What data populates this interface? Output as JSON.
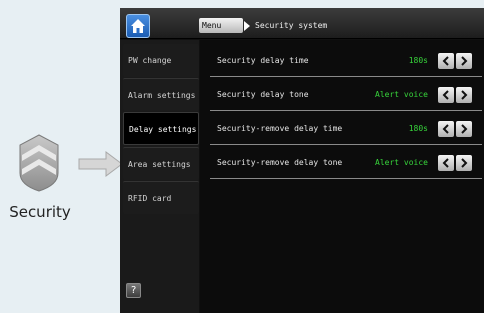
{
  "illustration": {
    "caption": "Security"
  },
  "header": {
    "home_icon": "home-icon",
    "breadcrumb_root": "Menu",
    "breadcrumb_current": "Security system"
  },
  "sidebar": {
    "items": [
      {
        "label": "PW change",
        "active": false
      },
      {
        "label": "Alarm settings",
        "active": false
      },
      {
        "label": "Delay settings",
        "active": true
      },
      {
        "label": "Area settings",
        "active": false
      },
      {
        "label": "RFID card",
        "active": false
      }
    ],
    "help_label": "?"
  },
  "settings": {
    "rows": [
      {
        "label": "Security delay time",
        "value": "180s"
      },
      {
        "label": "Security delay tone",
        "value": "Alert voice"
      },
      {
        "label": "Security-remove delay time",
        "value": "180s"
      },
      {
        "label": "Security-remove delay tone",
        "value": "Alert voice"
      }
    ]
  },
  "colors": {
    "value_green": "#37d43b",
    "home_blue": "#2a6fc8",
    "screen_bg": "#101010",
    "page_bg": "#e7eff3"
  }
}
